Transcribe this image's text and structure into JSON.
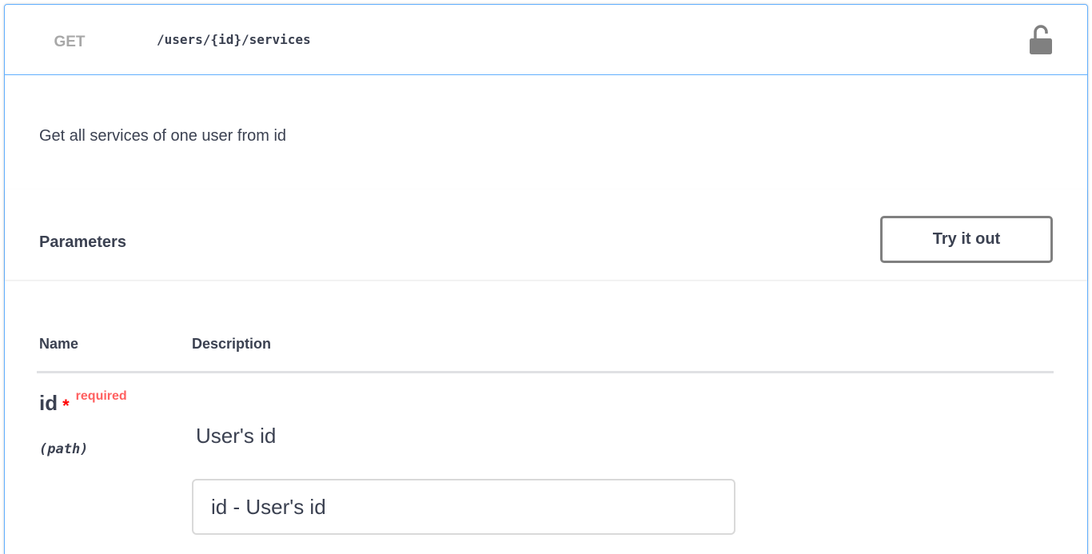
{
  "operation": {
    "method": "GET",
    "path": "/users/{id}/services",
    "lock_icon": "unlocked-padlock-icon",
    "description": "Get all services of one user from id"
  },
  "parameters_section": {
    "title": "Parameters",
    "try_button_label": "Try it out",
    "columns": {
      "name": "Name",
      "description": "Description"
    }
  },
  "parameters": [
    {
      "name": "id",
      "required_marker": "*",
      "required_label": "required",
      "location": "(path)",
      "description": "User's id",
      "input_placeholder": "id - User's id",
      "input_value": ""
    }
  ],
  "colors": {
    "accent": "#61affe",
    "method_text": "#a8a8a8",
    "required": "#ff6060",
    "text": "#3b4151"
  }
}
